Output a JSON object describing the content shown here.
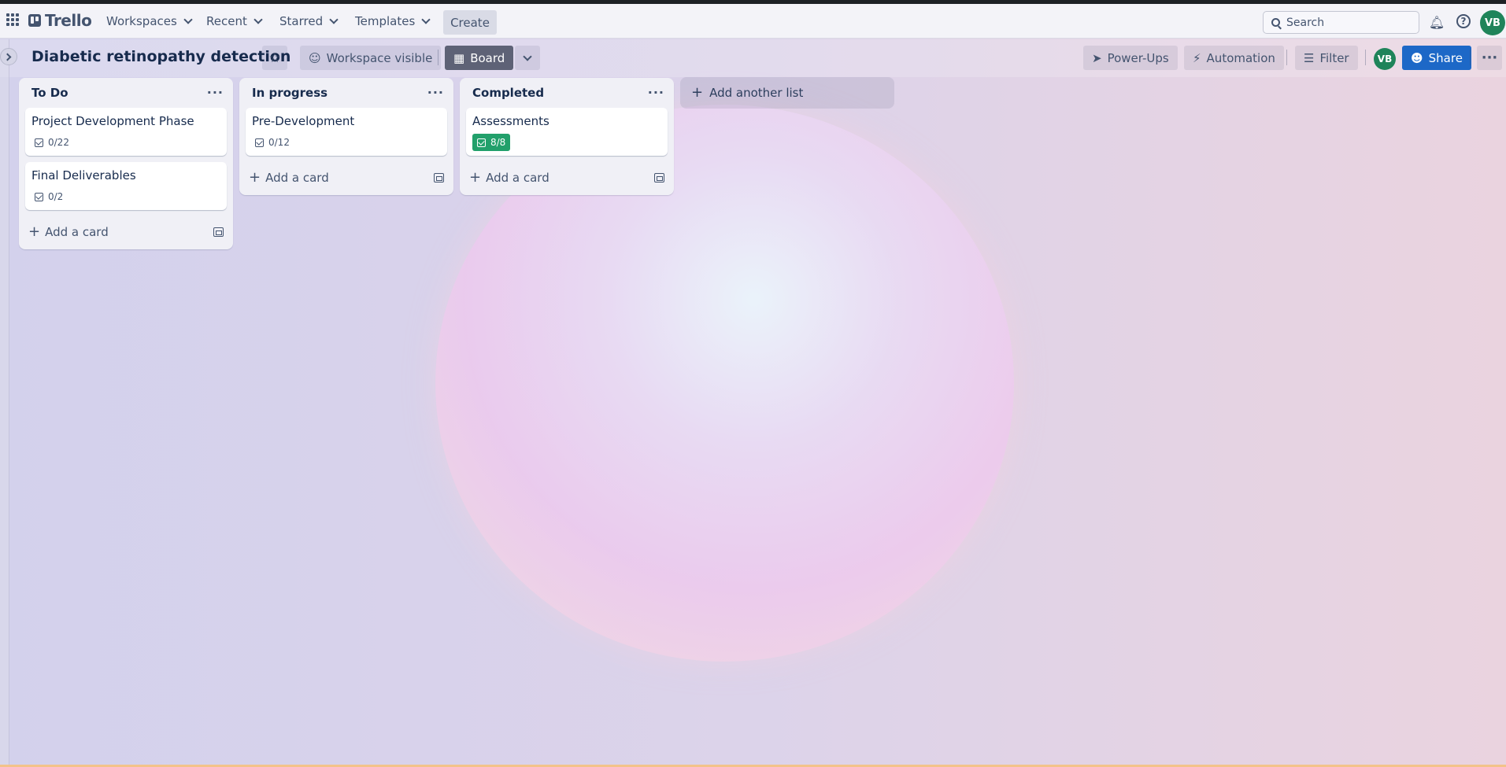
{
  "appbar": {
    "logo": "Trello",
    "nav": [
      "Workspaces",
      "Recent",
      "Starred",
      "Templates"
    ],
    "create_label": "Create",
    "search_placeholder": "Search",
    "avatar_initials": "VB"
  },
  "board": {
    "title": "Diabetic retinopathy detection",
    "visibility_label": "Workspace visible",
    "view_label": "Board",
    "powerups_label": "Power-Ups",
    "automation_label": "Automation",
    "filter_label": "Filter",
    "member_initials": "VB",
    "share_label": "Share",
    "add_list_label": "Add another list",
    "lists": [
      {
        "title": "To Do",
        "add_card_label": "Add a card",
        "cards": [
          {
            "title": "Project Development Phase",
            "checklist": "0/22",
            "complete": false
          },
          {
            "title": "Final Deliverables",
            "checklist": "0/2",
            "complete": false
          }
        ]
      },
      {
        "title": "In progress",
        "add_card_label": "Add a card",
        "cards": [
          {
            "title": "Pre-Development",
            "checklist": "0/12",
            "complete": false
          }
        ]
      },
      {
        "title": "Completed",
        "add_card_label": "Add a card",
        "cards": [
          {
            "title": "Assessments",
            "checklist": "8/8",
            "complete": true
          }
        ]
      }
    ]
  },
  "colors": {
    "accent_share": "#1d68c7",
    "avatar": "#1f845a",
    "checklist_complete": "#22a06b"
  }
}
